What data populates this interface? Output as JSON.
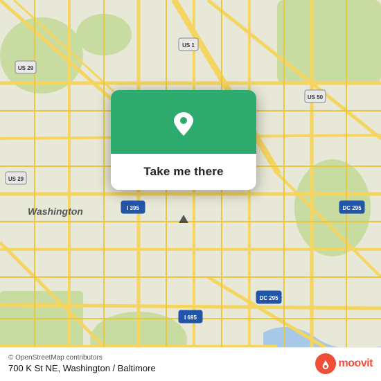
{
  "map": {
    "alt": "Street map of Washington DC / Baltimore area",
    "center_lat": 38.905,
    "center_lng": -76.99
  },
  "popup": {
    "button_label": "Take me there",
    "location_icon_alt": "location-pin"
  },
  "bottom_bar": {
    "osm_credit": "© OpenStreetMap contributors",
    "address": "700 K St NE, Washington / Baltimore",
    "moovit_label": "moovit"
  }
}
